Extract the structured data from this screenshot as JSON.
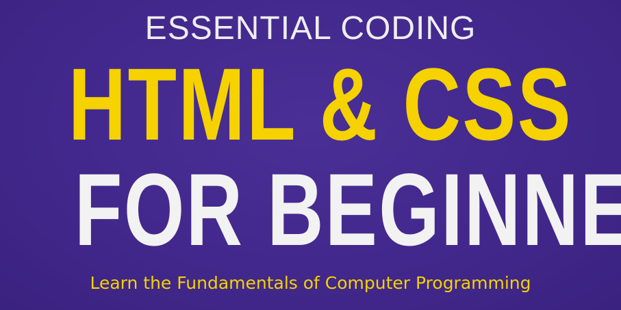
{
  "cover": {
    "eyebrow": "ESSENTIAL CODING",
    "title": "HTML & CSS",
    "subtitle": "FOR BEGINNERS",
    "tagline": "Learn the Fundamentals of Computer Programming"
  },
  "colors": {
    "background": "#42288c",
    "accent": "#f5d200",
    "light_text": "#f2f2f2"
  }
}
